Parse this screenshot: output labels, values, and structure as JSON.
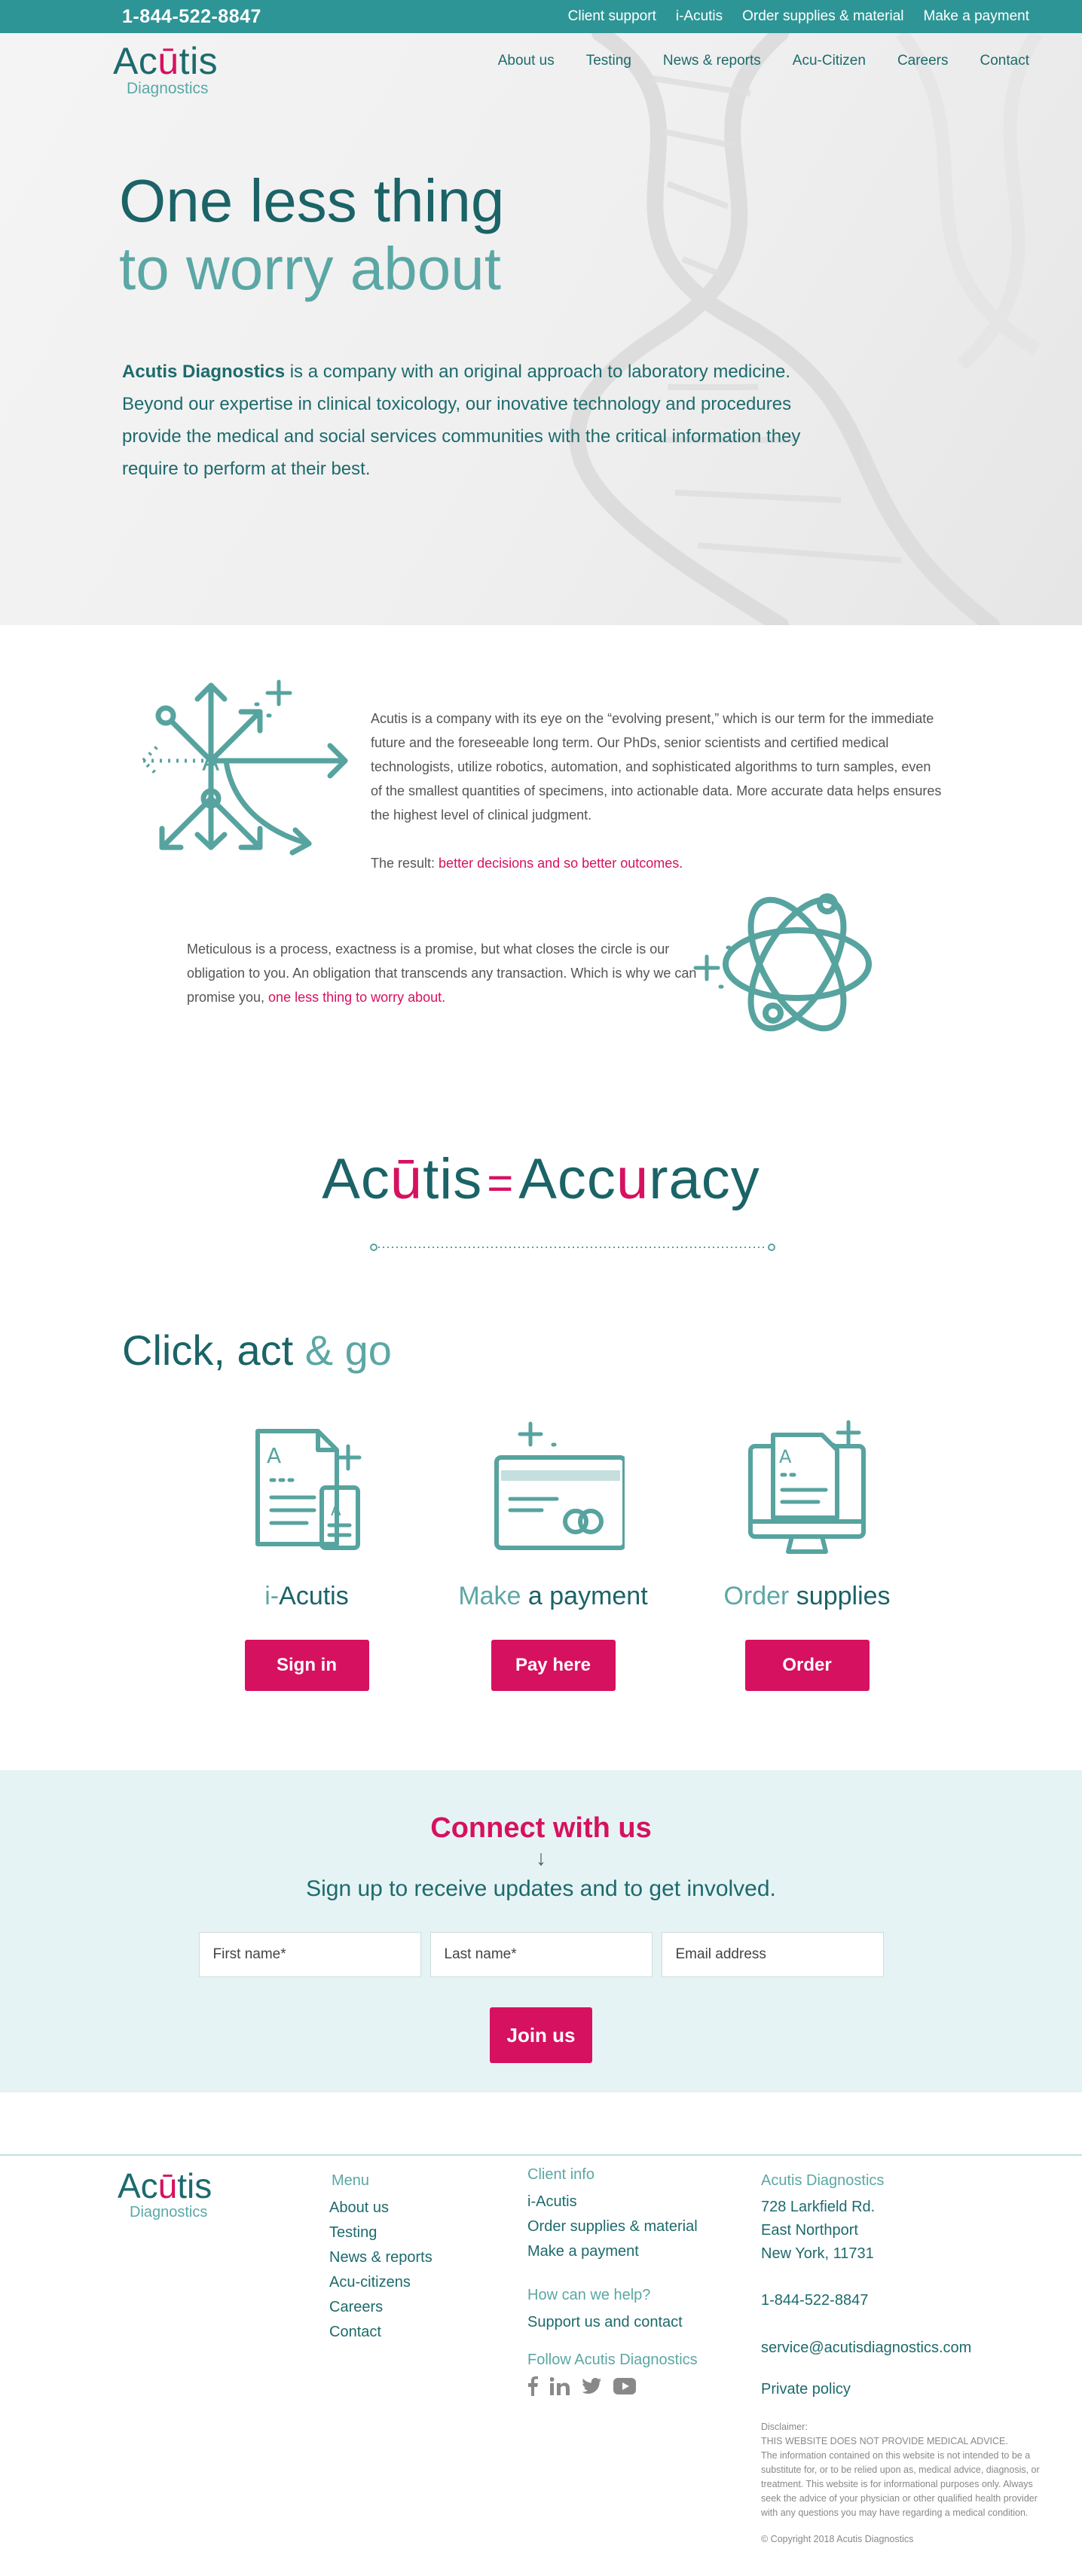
{
  "topbar": {
    "phone": "1-844-522-8847",
    "links": [
      "Client support",
      "i-Acutis",
      "Order supplies & material",
      "Make a payment"
    ]
  },
  "brand": {
    "name_pre": "Ac",
    "name_u": "ū",
    "name_post": "tis",
    "sub": "Diagnostics"
  },
  "nav": {
    "items": [
      "About us",
      "Testing",
      "News & reports",
      "Acu-Citizen",
      "Careers",
      "Contact"
    ]
  },
  "hero": {
    "title_line1": "One less thing",
    "title_line2": "to worry about",
    "intro_bold": "Acutis Diagnostics",
    "intro_rest": " is a company with an original approach to laboratory medicine. Beyond our expertise in clinical toxicology, our inovative technology and procedures provide the medical and social services communities with the critical information they require to perform at their best."
  },
  "about": {
    "paragraph1": "Acutis is a company with its eye on the “evolving present,” which is our term for the immediate future and the foreseeable long term. Our PhDs, senior scientists and certified medical technologists, utilize robotics, automation, and sophisticated algorithms to turn samples, even of the smallest quantities of specimens, into actionable data. More accurate data helps ensures the highest level of clinical judgment.",
    "result_label": "The result: ",
    "result_highlight": "better decisions and so better outcomes.",
    "paragraph2": "Meticulous is a process, exactness is a promise, but what closes the circle is our obligation to you. An obligation that transcends any transaction. Which is why we can promise you, ",
    "paragraph2_highlight": "one less thing to worry about."
  },
  "equation": {
    "left_pre": "Ac",
    "left_u": "ū",
    "left_post": "tis",
    "sign": "=",
    "right_pre": "Acc",
    "right_u": "u",
    "right_post": "racy"
  },
  "click_act_go": {
    "title_dark": "Click, act",
    "title_light": " & go",
    "cards": [
      {
        "title_light": "i-",
        "title_dark": "Acutis",
        "button": "Sign in"
      },
      {
        "title_light": "Make",
        "title_dark": " a payment",
        "button": "Pay here"
      },
      {
        "title_light": "Order",
        "title_dark": " supplies",
        "button": "Order"
      }
    ]
  },
  "connect": {
    "title": "Connect with us",
    "arrow": "↓",
    "subtitle": "Sign up to receive updates and to get involved.",
    "first_name_placeholder": "First name*",
    "last_name_placeholder": "Last name*",
    "email_placeholder": "Email address",
    "button": "Join us"
  },
  "footer": {
    "menu_head": "Menu",
    "menu_items": [
      "About us",
      "Testing",
      "News & reports",
      "Acu-citizens",
      "Careers",
      "Contact"
    ],
    "client_head": "Client info",
    "client_items": [
      "i-Acutis",
      "Order supplies & material",
      "Make a payment"
    ],
    "help_head": "How can we help?",
    "help_item": "Support us and contact",
    "follow_head": "Follow Acutis Diagnostics",
    "social_icons": [
      "facebook-icon",
      "linkedin-icon",
      "twitter-icon",
      "youtube-icon"
    ],
    "company_head": "Acutis Diagnostics",
    "address": [
      "728 Larkfield Rd.",
      "East Northport",
      "New York, 11731"
    ],
    "phone": "1-844-522-8847",
    "email": "service@acutisdiagnostics.com",
    "privacy": "Private policy",
    "disclaimer_title": "Disclaimer:",
    "disclaimer_line1": "THIS WEBSITE DOES NOT PROVIDE MEDICAL ADVICE.",
    "disclaimer_body": "The information contained on this website is not intended to be a substitute for, or to be relied upon as, medical advice, diagnosis, or treatment. This website is for informational purposes only. Always seek the advice of your physician or other qualified health provider with any questions you may have regarding a medical condition.",
    "copyright": "© Copyright 2018 Acutis Diagnostics"
  },
  "colors": {
    "teal": "#2e9596",
    "dark_teal": "#1b6367",
    "light_teal": "#5ba7a5",
    "pink": "#d6115f",
    "connect_bg": "#e6f3f4"
  }
}
